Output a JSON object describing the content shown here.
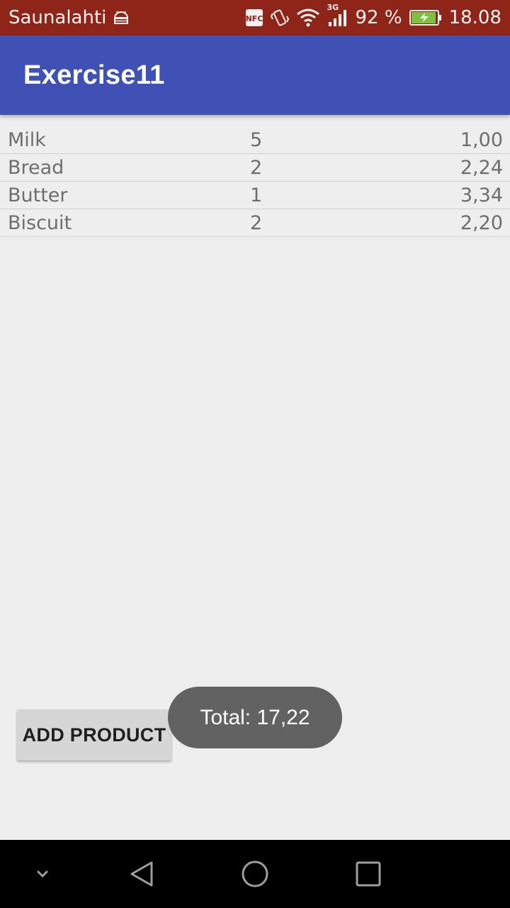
{
  "status_bar": {
    "carrier": "Saunalahti",
    "network_type": "3G",
    "battery_percent": "92 %",
    "time": "18.08",
    "icons": [
      "android-debug-icon",
      "nfc-icon",
      "vibrate-icon",
      "wifi-icon",
      "signal-icon",
      "battery-charging-icon"
    ],
    "nfc_label": "NFC"
  },
  "app_bar": {
    "title": "Exercise11",
    "color": "#3f51b5"
  },
  "products": [
    {
      "name": "Milk",
      "quantity": "5",
      "price": "1,00"
    },
    {
      "name": "Bread",
      "quantity": "2",
      "price": "2,24"
    },
    {
      "name": "Butter",
      "quantity": "1",
      "price": "3,34"
    },
    {
      "name": "Biscuit",
      "quantity": "2",
      "price": "2,20"
    }
  ],
  "add_button": {
    "label": "ADD PRODUCT"
  },
  "toast": {
    "message": "Total: 17,22"
  },
  "nav_bar": {
    "icons": [
      "hide-keyboard-icon",
      "back-icon",
      "home-icon",
      "recents-icon"
    ]
  }
}
